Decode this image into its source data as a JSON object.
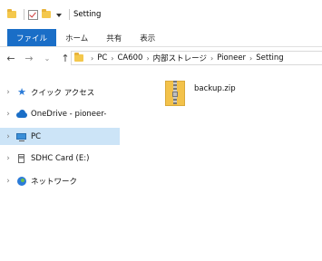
{
  "window": {
    "title": "Setting"
  },
  "ribbon": {
    "tabs": [
      "ファイル",
      "ホーム",
      "共有",
      "表示"
    ]
  },
  "navigation": {
    "back": "←",
    "forward": "→",
    "recent": "⌄",
    "up": "↑"
  },
  "address": {
    "crumbs": [
      "PC",
      "CA600",
      "内部ストレージ",
      "Pioneer",
      "Setting"
    ]
  },
  "sidebar": {
    "items": [
      {
        "label": "クイック アクセス",
        "icon": "star-icon"
      },
      {
        "label": "OneDrive - pioneer-",
        "icon": "cloud-icon"
      },
      {
        "label": "PC",
        "icon": "pc-icon",
        "selected": true
      },
      {
        "label": "SDHC Card (E:)",
        "icon": "sd-card-icon"
      },
      {
        "label": "ネットワーク",
        "icon": "network-icon"
      }
    ]
  },
  "files": [
    {
      "name": "backup.zip",
      "icon": "zip-file-icon"
    }
  ],
  "colors": {
    "file_tab": "#1a6ec7",
    "selected_row": "#cce4f7",
    "folder": "#f4c84c"
  }
}
